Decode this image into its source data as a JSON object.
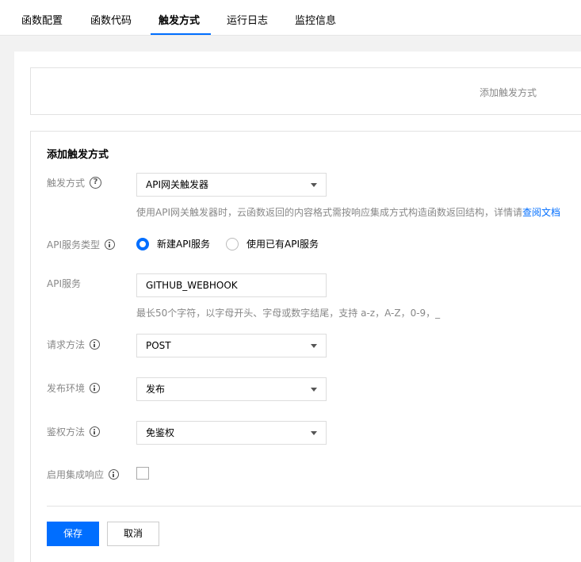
{
  "tabs": [
    {
      "label": "函数配置"
    },
    {
      "label": "函数代码"
    },
    {
      "label": "触发方式"
    },
    {
      "label": "运行日志"
    },
    {
      "label": "监控信息"
    }
  ],
  "active_tab": "触发方式",
  "trigger_list": {
    "add_link": "添加触发方式"
  },
  "form": {
    "title": "添加触发方式",
    "trigger_type": {
      "label": "触发方式",
      "value": "API网关触发器",
      "help_text": "使用API网关触发器时，云函数返回的内容格式需按响应集成方式构造函数返回结构，详情请",
      "help_link": "查阅文档"
    },
    "api_service_type": {
      "label": "API服务类型",
      "options": [
        {
          "label": "新建API服务",
          "checked": true
        },
        {
          "label": "使用已有API服务",
          "checked": false
        }
      ]
    },
    "api_service": {
      "label": "API服务",
      "value": "GITHUB_WEBHOOK",
      "help_text": "最长50个字符，以字母开头、字母或数字结尾，支持 a-z，A-Z，0-9，_"
    },
    "request_method": {
      "label": "请求方法",
      "value": "POST"
    },
    "release_env": {
      "label": "发布环境",
      "value": "发布"
    },
    "auth_method": {
      "label": "鉴权方法",
      "value": "免鉴权"
    },
    "integration_response": {
      "label": "启用集成响应",
      "checked": false
    },
    "save_label": "保存",
    "cancel_label": "取消"
  },
  "colors": {
    "accent": "#006eff",
    "background": "#f2f2f2",
    "border": "#e2e2e2",
    "muted_text": "#888888"
  }
}
